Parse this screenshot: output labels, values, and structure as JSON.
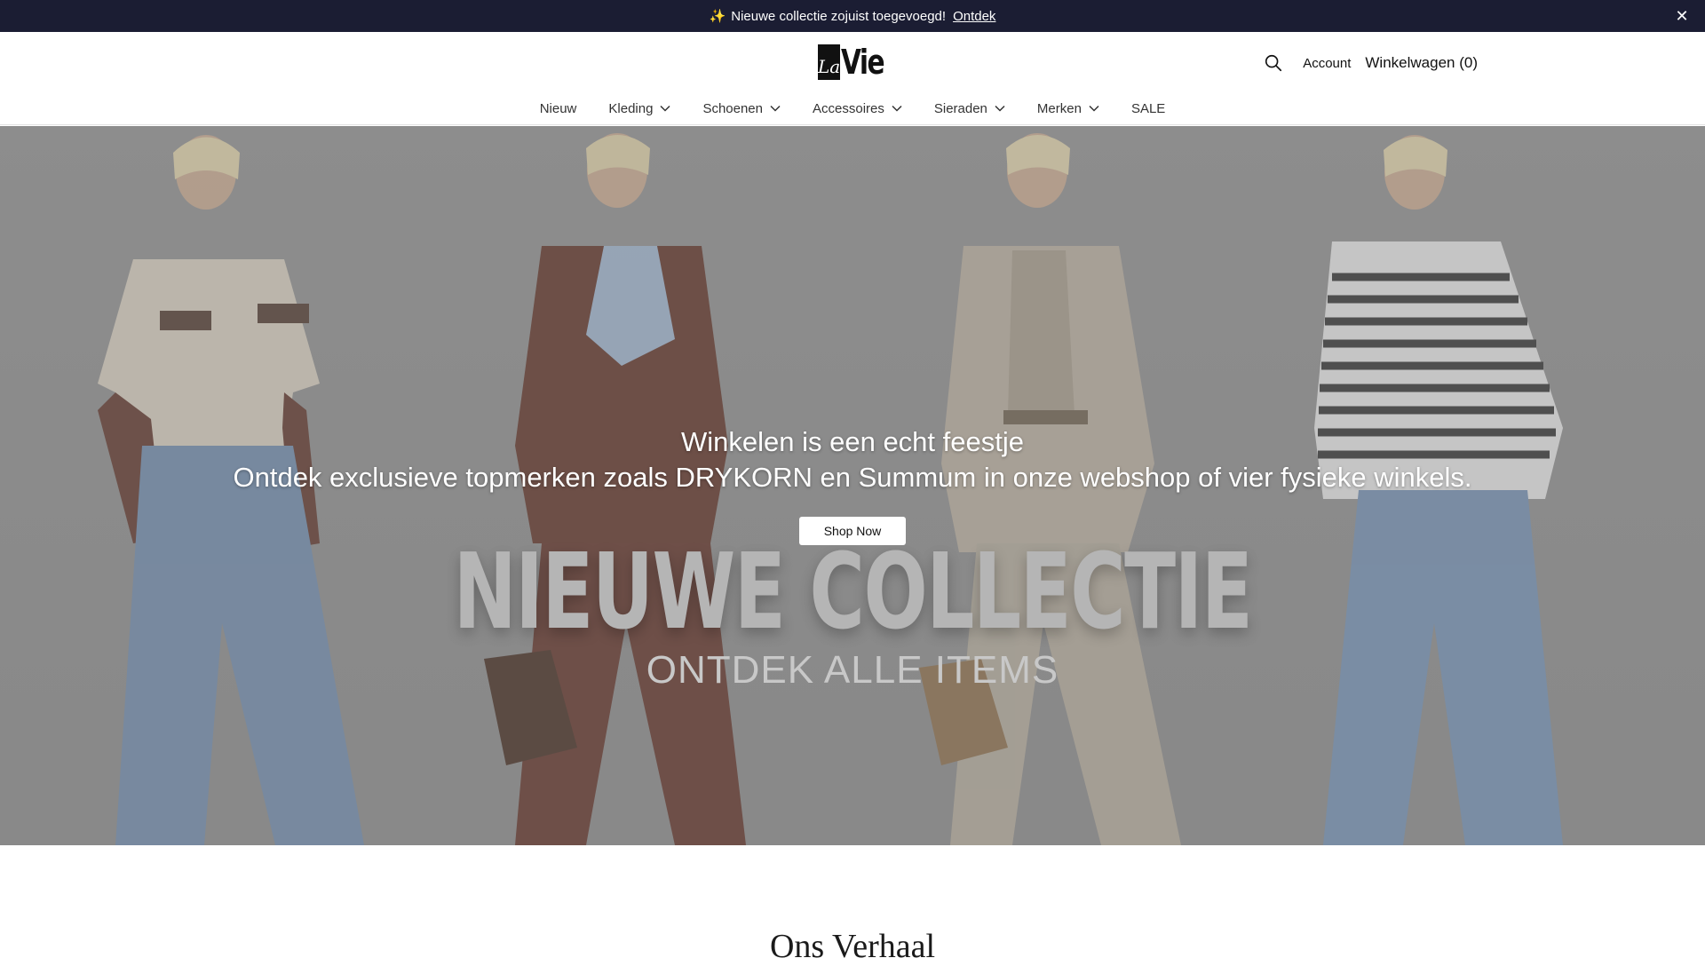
{
  "announcement": {
    "icon": "sparkles-icon",
    "text": "Nieuwe collectie zojuist toegevoegd!",
    "link": "Ontdek",
    "close": "✕"
  },
  "header": {
    "logo": {
      "la": "La",
      "vie": "Vie"
    },
    "account": "Account",
    "cart": "Winkelwagen (0)"
  },
  "nav": {
    "items": [
      {
        "label": "Nieuw",
        "dropdown": false
      },
      {
        "label": "Kleding",
        "dropdown": true
      },
      {
        "label": "Schoenen",
        "dropdown": true
      },
      {
        "label": "Accessoires",
        "dropdown": true
      },
      {
        "label": "Sieraden",
        "dropdown": true
      },
      {
        "label": "Merken",
        "dropdown": true
      },
      {
        "label": "SALE",
        "dropdown": false
      }
    ]
  },
  "hero": {
    "title": "Winkelen is een echt feestje",
    "description": "Ontdek exclusieve topmerken zoals DRYKORN en Summum in onze webshop of vier fysieke winkels.",
    "button": "Shop Now",
    "image_text_big": "NIEUWE COLLECTIE",
    "image_text_sub": "ONTDEK ALLE ITEMS"
  },
  "story": {
    "title": "Ons Verhaal"
  },
  "colors": {
    "announce_bg": "#1b1d33",
    "hero_overlay": "#8a8a8a",
    "text": "#1a1a1a"
  }
}
